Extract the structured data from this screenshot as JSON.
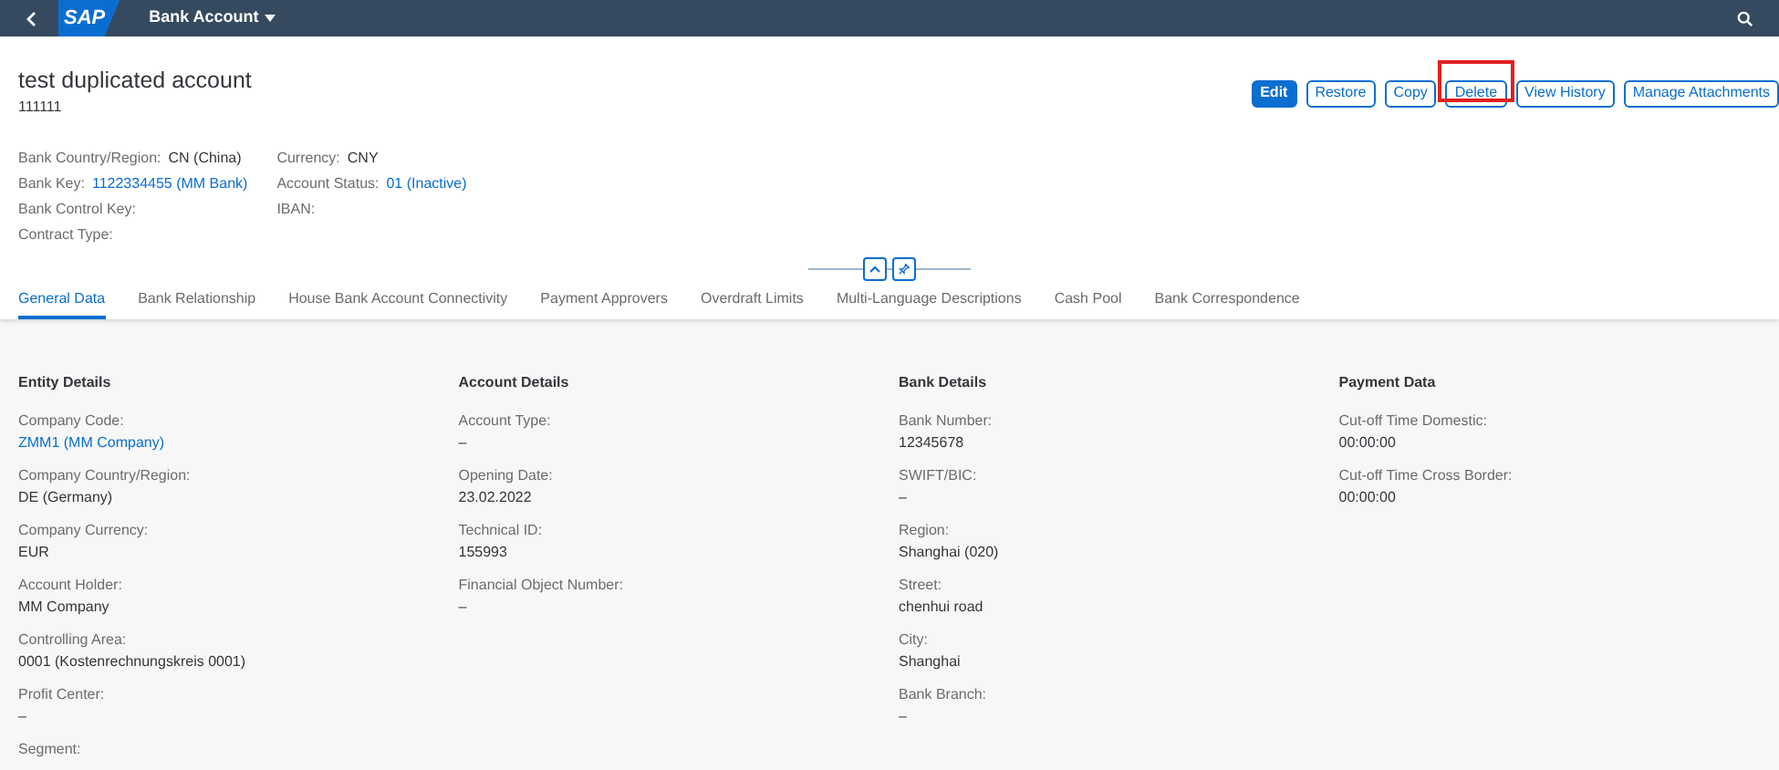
{
  "shell": {
    "title": "Bank Account",
    "logo": "SAP"
  },
  "header": {
    "title": "test duplicated account",
    "subtitle": "111111",
    "actions": [
      {
        "label": "Edit",
        "kind": "emphasized",
        "highlighted": false
      },
      {
        "label": "Restore",
        "kind": "default",
        "highlighted": false
      },
      {
        "label": "Copy",
        "kind": "default",
        "highlighted": false
      },
      {
        "label": "Delete",
        "kind": "default",
        "highlighted": true
      },
      {
        "label": "View History",
        "kind": "default",
        "highlighted": false
      },
      {
        "label": "Manage Attachments",
        "kind": "default",
        "highlighted": false
      }
    ],
    "attribute_columns": [
      [
        {
          "label": "Bank Country/Region:",
          "value": "CN (China)",
          "link": false
        },
        {
          "label": "Bank Key:",
          "value": "1122334455 (MM Bank)",
          "link": true
        },
        {
          "label": "Bank Control Key:"
        },
        {
          "label": "Contract Type:"
        }
      ],
      [
        {
          "label": "Currency:",
          "value": "CNY",
          "link": false
        },
        {
          "label": "Account Status:",
          "value": "01 (Inactive)",
          "link": true
        },
        {
          "label": "IBAN:"
        }
      ]
    ]
  },
  "tabs": [
    {
      "label": "General Data",
      "selected": true
    },
    {
      "label": "Bank Relationship",
      "selected": false
    },
    {
      "label": "House Bank Account Connectivity",
      "selected": false
    },
    {
      "label": "Payment Approvers",
      "selected": false
    },
    {
      "label": "Overdraft Limits",
      "selected": false
    },
    {
      "label": "Multi-Language Descriptions",
      "selected": false
    },
    {
      "label": "Cash Pool",
      "selected": false
    },
    {
      "label": "Bank Correspondence",
      "selected": false
    }
  ],
  "sections": [
    {
      "title": "Entity Details",
      "fields": [
        {
          "label": "Company Code:",
          "value": "ZMM1 (MM Company)",
          "link": true
        },
        {
          "label": "Company Country/Region:",
          "value": "DE (Germany)",
          "link": false
        },
        {
          "label": "Company Currency:",
          "value": "EUR",
          "link": false
        },
        {
          "label": "Account Holder:",
          "value": "MM Company",
          "link": false
        },
        {
          "label": "Controlling Area:",
          "value": "0001 (Kostenrechnungskreis 0001)",
          "link": false
        },
        {
          "label": "Profit Center:",
          "value": "–",
          "link": false
        },
        {
          "label": "Segment:"
        }
      ]
    },
    {
      "title": "Account Details",
      "fields": [
        {
          "label": "Account Type:",
          "value": "–",
          "link": false
        },
        {
          "label": "Opening Date:",
          "value": "23.02.2022",
          "link": false
        },
        {
          "label": "Technical ID:",
          "value": "155993",
          "link": false
        },
        {
          "label": "Financial Object Number:",
          "value": "–",
          "link": false
        }
      ]
    },
    {
      "title": "Bank Details",
      "fields": [
        {
          "label": "Bank Number:",
          "value": "12345678",
          "link": false
        },
        {
          "label": "SWIFT/BIC:",
          "value": "–",
          "link": false
        },
        {
          "label": "Region:",
          "value": "Shanghai (020)",
          "link": false
        },
        {
          "label": "Street:",
          "value": "chenhui road",
          "link": false
        },
        {
          "label": "City:",
          "value": "Shanghai",
          "link": false
        },
        {
          "label": "Bank Branch:",
          "value": "–",
          "link": false
        }
      ]
    },
    {
      "title": "Payment Data",
      "fields": [
        {
          "label": "Cut-off Time Domestic:",
          "value": "00:00:00",
          "link": false
        },
        {
          "label": "Cut-off Time Cross Border:",
          "value": "00:00:00",
          "link": false
        }
      ]
    }
  ]
}
